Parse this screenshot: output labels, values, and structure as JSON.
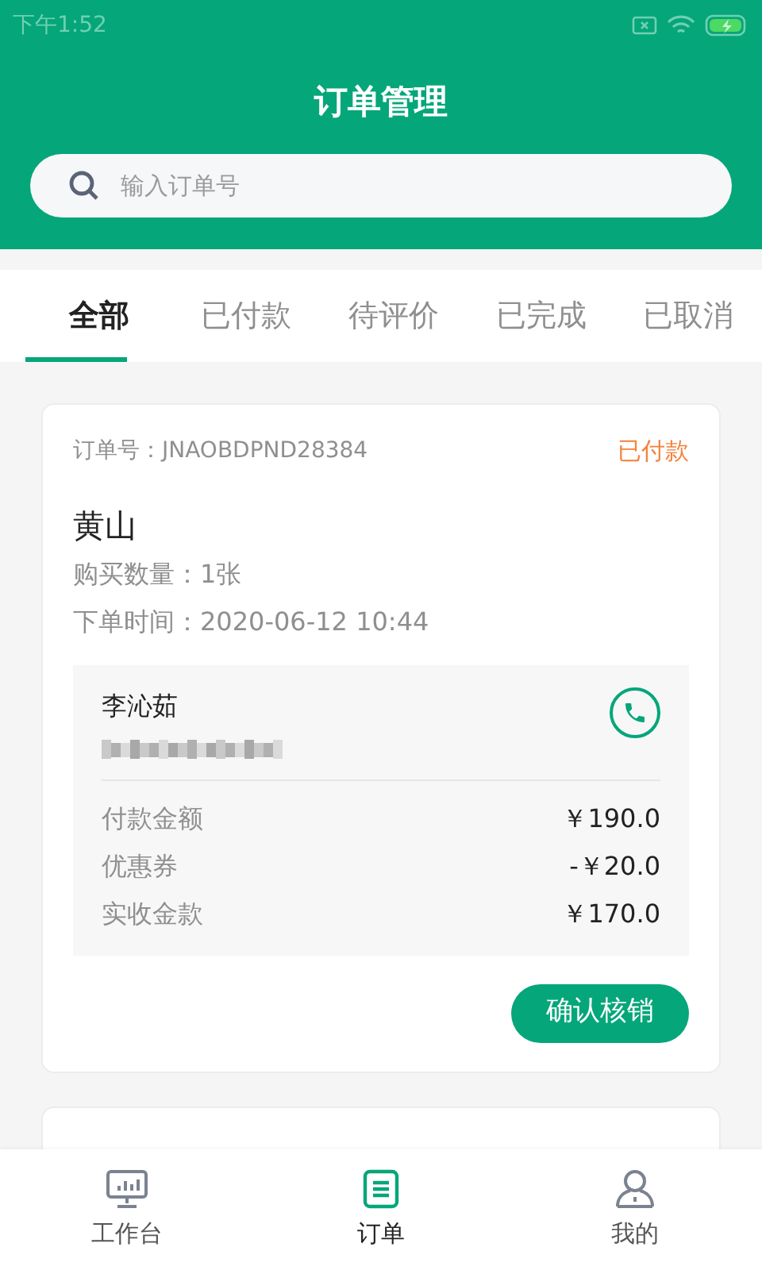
{
  "status_bar": {
    "time": "下午1:52"
  },
  "header": {
    "title": "订单管理"
  },
  "search": {
    "placeholder": "输入订单号"
  },
  "tabs": [
    {
      "label": "全部",
      "selected": true
    },
    {
      "label": "已付款",
      "selected": false
    },
    {
      "label": "待评价",
      "selected": false
    },
    {
      "label": "已完成",
      "selected": false
    },
    {
      "label": "已取消",
      "selected": false
    }
  ],
  "orders": [
    {
      "order_no": "订单号：JNAOBDPND28384",
      "status": "已付款",
      "product": "黄山",
      "quantity": "购买数量：1张",
      "time": "下单时间：2020-06-12 10:44",
      "customer": {
        "name": "李沁茹"
      },
      "amounts": [
        {
          "label": "付款金额",
          "value": "￥190.0"
        },
        {
          "label": "优惠券",
          "value": "-￥20.0"
        },
        {
          "label": "实收金款",
          "value": "￥170.0"
        }
      ],
      "action": "确认核销"
    }
  ],
  "bottom_nav": [
    {
      "kind": "dashboard",
      "label": "工作台",
      "selected": false
    },
    {
      "kind": "orders",
      "label": "订单",
      "selected": true
    },
    {
      "kind": "profile",
      "label": "我的",
      "selected": false
    }
  ]
}
